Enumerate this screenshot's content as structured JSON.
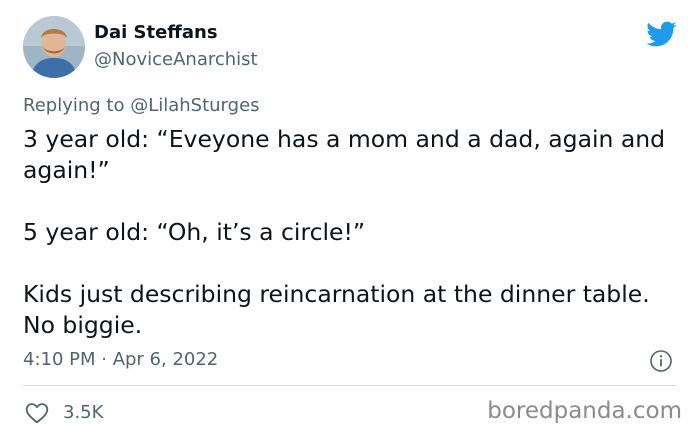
{
  "user": {
    "display_name": "Dai Steffans",
    "handle": "@NoviceAnarchist"
  },
  "tweet": {
    "replying_to": "Replying to @LilahSturges",
    "paragraphs": [
      "3 year old: “Eveyone has a mom and a dad, again and again!”",
      "5 year old: “Oh, it’s a circle!”",
      "Kids just describing reincarnation at the dinner table. No biggie."
    ],
    "timestamp": "4:10 PM · Apr 6, 2022",
    "like_count": "3.5K"
  },
  "watermark": "boredpanda.com",
  "icons": {
    "brand": "twitter-bird-icon",
    "info": "info-icon",
    "like": "heart-icon"
  },
  "colors": {
    "twitter_blue": "#1d9bf0",
    "text_primary": "#0f1419",
    "text_secondary": "#536471",
    "divider": "#cfd9de",
    "watermark": "#8b8b8b"
  }
}
